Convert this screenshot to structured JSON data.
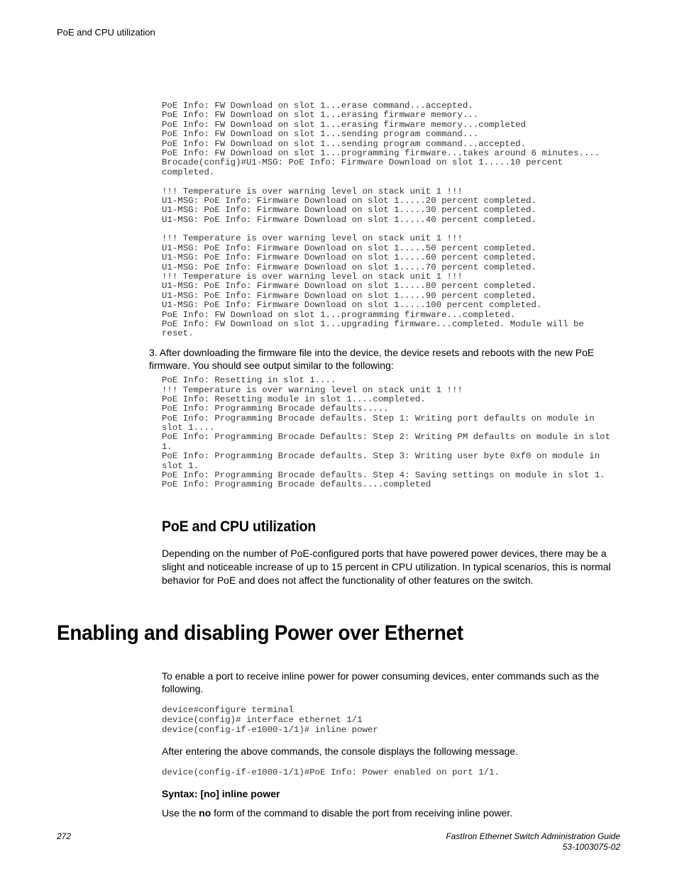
{
  "header": {
    "running": "PoE and CPU utilization"
  },
  "code_block_1": "PoE Info: FW Download on slot 1...erase command...accepted.\nPoE Info: FW Download on slot 1...erasing firmware memory...\nPoE Info: FW Download on slot 1...erasing firmware memory...completed\nPoE Info: FW Download on slot 1...sending program command...\nPoE Info: FW Download on slot 1...sending program command...accepted.\nPoE Info: FW Download on slot 1...programming firmware...takes around 6 minutes....\nBrocade(config)#U1-MSG: PoE Info: Firmware Download on slot 1.....10 percent completed.\n\n!!! Temperature is over warning level on stack unit 1 !!!\nU1-MSG: PoE Info: Firmware Download on slot 1.....20 percent completed.\nU1-MSG: PoE Info: Firmware Download on slot 1.....30 percent completed.\nU1-MSG: PoE Info: Firmware Download on slot 1.....40 percent completed.\n\n!!! Temperature is over warning level on stack unit 1 !!!\nU1-MSG: PoE Info: Firmware Download on slot 1.....50 percent completed.\nU1-MSG: PoE Info: Firmware Download on slot 1.....60 percent completed.\nU1-MSG: PoE Info: Firmware Download on slot 1.....70 percent completed.\n!!! Temperature is over warning level on stack unit 1 !!!\nU1-MSG: PoE Info: Firmware Download on slot 1.....80 percent completed.\nU1-MSG: PoE Info: Firmware Download on slot 1.....90 percent completed.\nU1-MSG: PoE Info: Firmware Download on slot 1.....100 percent completed.\nPoE Info: FW Download on slot 1...programming firmware...completed.\nPoE Info: FW Download on slot 1...upgrading firmware...completed. Module will be reset.",
  "step3": "3. After downloading the firmware file into the device, the device resets and reboots with the new PoE firmware. You should see output similar to the following:",
  "code_block_2": "PoE Info: Resetting in slot 1....\n!!! Temperature is over warning level on stack unit 1 !!!\nPoE Info: Resetting module in slot 1....completed.\nPoE Info: Programming Brocade defaults.....\nPoE Info: Programming Brocade defaults. Step 1: Writing port defaults on module in slot 1....\nPoE Info: Programming Brocade Defaults: Step 2: Writing PM defaults on module in slot 1.\nPoE Info: Programming Brocade defaults. Step 3: Writing user byte 0xf0 on module in slot 1.\nPoE Info: Programming Brocade defaults. Step 4: Saving settings on module in slot 1.\nPoE Info: Programming Brocade defaults....completed",
  "section_cpu": {
    "title": "PoE and CPU utilization",
    "body": "Depending on the number of PoE-configured ports that have powered power devices, there may be a slight and noticeable increase of up to 15 percent in CPU utilization. In typical scenarios, this is normal behavior for PoE and does not affect the functionality of other features on the switch."
  },
  "section_enable": {
    "title": "Enabling and disabling Power over Ethernet",
    "intro": "To enable a port to receive inline power for power consuming devices, enter commands such as the following.",
    "code1": "device#configure terminal\ndevice(config)# interface ethernet 1/1\ndevice(config-if-e1000-1/1)# inline power",
    "after": "After entering the above commands, the console displays the following message.",
    "code2": "device(config-if-e1000-1/1)#PoE Info: Power enabled on port 1/1.",
    "syntax": "Syntax: [no] inline power",
    "use_pre": "Use the ",
    "use_bold": "no",
    "use_post": " form of the command to disable the port from receiving inline power."
  },
  "footer": {
    "page": "272",
    "doc_title": "FastIron Ethernet Switch Administration Guide",
    "doc_num": "53-1003075-02"
  }
}
